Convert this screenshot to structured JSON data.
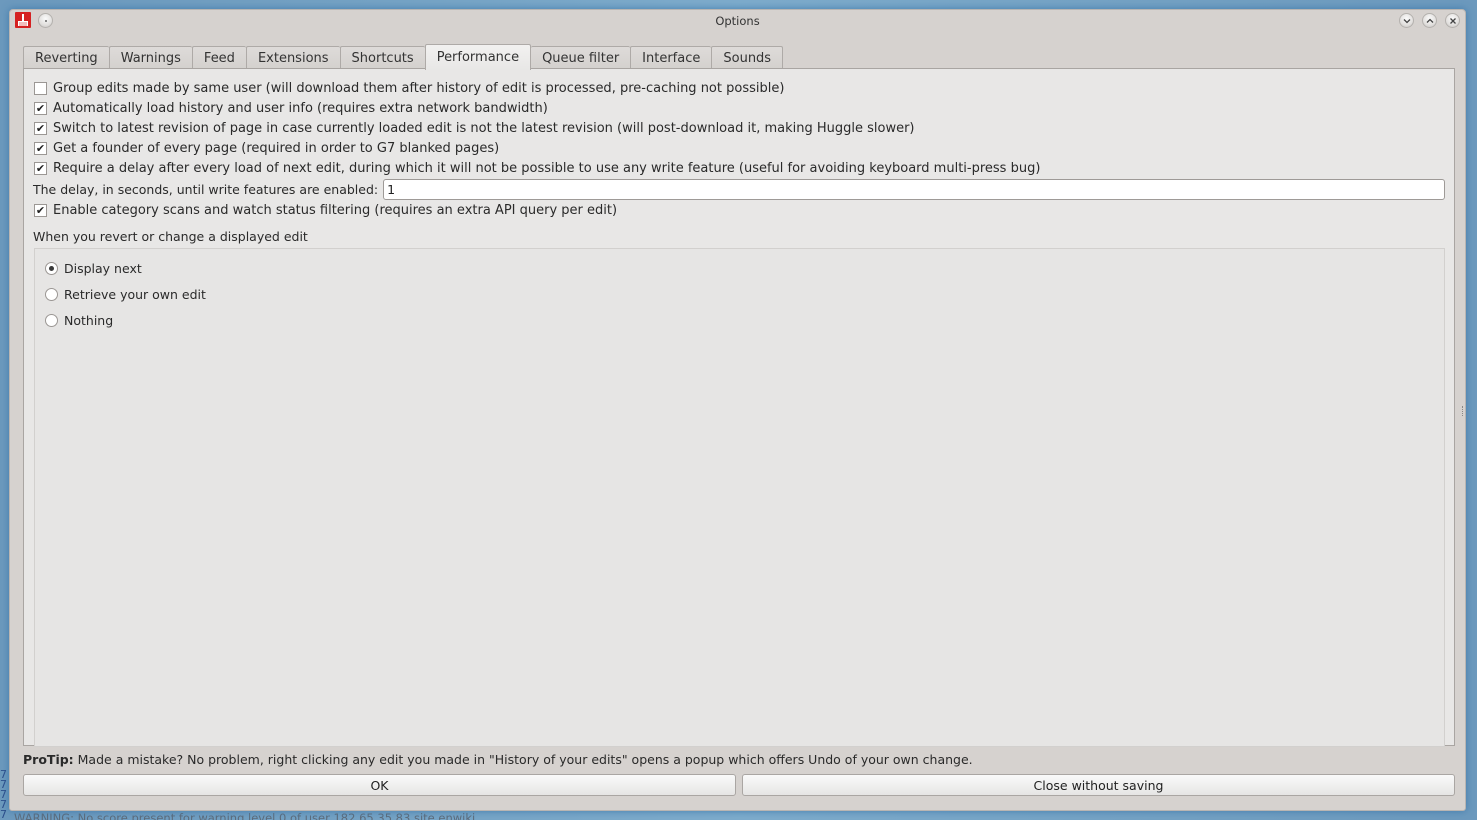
{
  "background": {
    "status_text": "WARNING: No score present for warning level 0 of user 182.65.35.83 site enwiki",
    "left_strip_text": "7\n7\n7\n7\n7"
  },
  "window": {
    "title": "Options",
    "app_icon": "huggle-broom-icon",
    "controls": {
      "sticky": "pin-icon",
      "minimize": "chevron-down-icon",
      "maximize": "chevron-up-icon",
      "close": "close-icon"
    }
  },
  "tabs": [
    {
      "label": "Reverting",
      "active": false
    },
    {
      "label": "Warnings",
      "active": false
    },
    {
      "label": "Feed",
      "active": false
    },
    {
      "label": "Extensions",
      "active": false
    },
    {
      "label": "Shortcuts",
      "active": false
    },
    {
      "label": "Performance",
      "active": true
    },
    {
      "label": "Queue filter",
      "active": false
    },
    {
      "label": "Interface",
      "active": false
    },
    {
      "label": "Sounds",
      "active": false
    }
  ],
  "performance": {
    "checkboxes": [
      {
        "label": "Group edits made by same user (will download them after history of edit is processed, pre-caching not possible)",
        "checked": false
      },
      {
        "label": "Automatically load history and user info (requires extra network bandwidth)",
        "checked": true
      },
      {
        "label": "Switch to latest revision of page in case currently loaded edit is not the latest revision (will post-download it, making Huggle slower)",
        "checked": true
      },
      {
        "label": "Get a founder of every page (required in order to G7 blanked pages)",
        "checked": true
      },
      {
        "label": "Require a delay after every load of next edit, during which it will not be possible to use any write feature (useful for avoiding keyboard multi-press bug)",
        "checked": true
      }
    ],
    "delay": {
      "label": "The delay, in seconds, until write features are enabled:",
      "value": "1"
    },
    "category_scan": {
      "label": "Enable category scans and watch status filtering (requires an extra API query per edit)",
      "checked": true
    },
    "revert_group": {
      "label": "When you revert or change a displayed edit",
      "options": [
        {
          "label": "Display next",
          "selected": true
        },
        {
          "label": "Retrieve your own edit",
          "selected": false
        },
        {
          "label": "Nothing",
          "selected": false
        }
      ]
    }
  },
  "protip": {
    "prefix": "ProTip:",
    "text": " Made a mistake? No problem, right clicking any edit you made in \"History of your edits\" opens a popup which offers Undo of your own change."
  },
  "buttons": {
    "ok": "OK",
    "close_without_saving": "Close without saving"
  },
  "check_glyph": "✔"
}
